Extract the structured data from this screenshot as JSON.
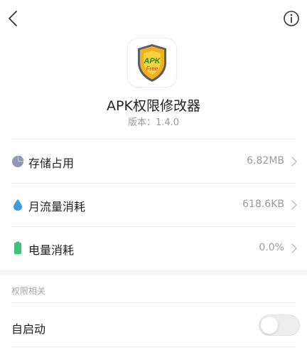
{
  "header": {
    "back_icon": "chevron-left-icon",
    "info_icon": "info-icon"
  },
  "app": {
    "name": "APK权限修改器",
    "version": "版本：1.4.0",
    "icon_text_top": "APK",
    "icon_text_bottom": "Free",
    "icon_colors": {
      "shield_outer": "#f0b020",
      "shield_inner": "#f6d33e",
      "shield_border": "#5a5f66"
    }
  },
  "rows": [
    {
      "label": "存储占用",
      "value": "6.82MB",
      "icon": "pie-chart-icon",
      "color": "#8e98b5"
    },
    {
      "label": "月流量消耗",
      "value": "618.6KB",
      "icon": "water-drop-icon",
      "color": "#3d9be0"
    },
    {
      "label": "电量消耗",
      "value": "0.0%",
      "icon": "battery-icon",
      "color": "#3cc478"
    }
  ],
  "permissions": {
    "section_title": "权限相关",
    "autostart": {
      "label": "自启动",
      "enabled": false
    }
  }
}
